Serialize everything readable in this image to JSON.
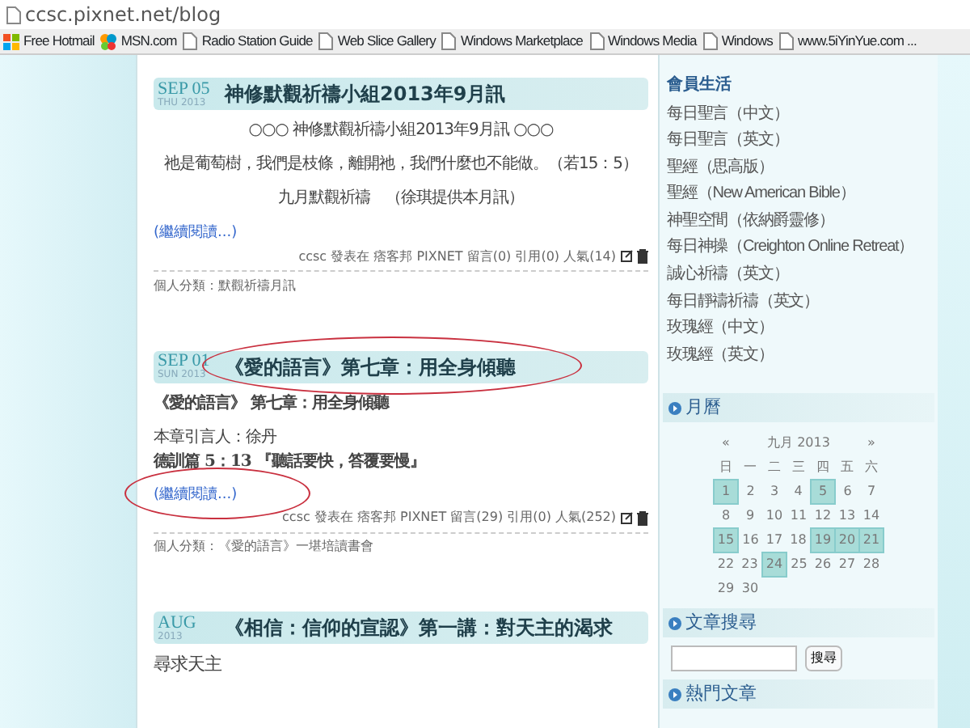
{
  "address_bar": {
    "url": "ccsc.pixnet.net/blog"
  },
  "bookmarks": [
    {
      "kind": "windows",
      "label": "Free Hotmail"
    },
    {
      "kind": "msn",
      "label": "MSN.com"
    },
    {
      "kind": "page",
      "label": "Radio Station Guide"
    },
    {
      "kind": "page",
      "label": "Web Slice Gallery"
    },
    {
      "kind": "page",
      "label": "Windows Marketplace"
    },
    {
      "kind": "page",
      "label": "Windows Media"
    },
    {
      "kind": "page",
      "label": "Windows"
    },
    {
      "kind": "page",
      "label": "www.5iYinYue.com ..."
    }
  ],
  "posts": [
    {
      "month_day": "SEP 05",
      "weekday_year": "THU 2013",
      "title": "神修默觀祈禱小組2013年9月訊",
      "circled_title": false,
      "body": [
        {
          "kind": "center",
          "text": "○○○  神修默觀祈禱小組2013年9月訊  ○○○"
        },
        {
          "kind": "center",
          "text": "祂是葡萄樹，我們是枝條，離開祂，我們什麼也不能做。（若15：5）"
        },
        {
          "kind": "center",
          "text": "九月默觀祈禱　（徐琪提供本月訊）"
        }
      ],
      "read_more": "(繼續閱讀...)",
      "circled_read_more": false,
      "footer": "ccsc 發表在 痞客邦 PIXNET 留言(0) 引用(0) 人氣(14)",
      "category": "個人分類：默觀祈禱月訊"
    },
    {
      "month_day": "SEP 01",
      "weekday_year": "SUN 2013",
      "title": "《愛的語言》第七章：用全身傾聽",
      "circled_title": true,
      "body": [
        {
          "kind": "heading",
          "text": "《愛的語言》 第七章：用全身傾聽"
        },
        {
          "kind": "plain",
          "text": "本章引言人：徐丹"
        },
        {
          "kind": "verse",
          "text": "德訓篇 5：13 『聽話要快，答覆要慢』"
        }
      ],
      "read_more": "(繼續閱讀...)",
      "circled_read_more": true,
      "footer": "ccsc 發表在 痞客邦 PIXNET 留言(29) 引用(0) 人氣(252)",
      "category": "個人分類：《愛的語言》一堪培讀書會"
    },
    {
      "month_day": "AUG",
      "weekday_year": "2013",
      "title": "《相信：信仰的宣認》第一講：對天主的渴求",
      "circled_title": false,
      "body": [
        {
          "kind": "lead",
          "text": "尋求天主"
        }
      ]
    }
  ],
  "sidebar": {
    "links_heading": "會員生活",
    "links": [
      "每日聖言（中文）",
      "每日聖言（英文）",
      "聖經（思高版）",
      "聖經（New American Bible）",
      "神聖空間（依納爵靈修）",
      "每日神操（Creighton Online Retreat）",
      "誠心祈禱（英文）",
      "每日靜禱祈禱（英文）",
      "玫瑰經（中文）",
      "玫瑰經（英文）"
    ],
    "calendar": {
      "heading": "月曆",
      "prev": "«",
      "month": "九月 2013",
      "next": "»",
      "weekdays": [
        "日",
        "一",
        "二",
        "三",
        "四",
        "五",
        "六"
      ],
      "weeks": [
        [
          {
            "day": "1",
            "has_post": true
          },
          {
            "day": "2",
            "has_post": false
          },
          {
            "day": "3",
            "has_post": false
          },
          {
            "day": "4",
            "has_post": false
          },
          {
            "day": "5",
            "has_post": true
          },
          {
            "day": "6",
            "has_post": false
          },
          {
            "day": "7",
            "has_post": false
          }
        ],
        [
          {
            "day": "8",
            "has_post": false
          },
          {
            "day": "9",
            "has_post": false
          },
          {
            "day": "10",
            "has_post": false
          },
          {
            "day": "11",
            "has_post": false
          },
          {
            "day": "12",
            "has_post": false
          },
          {
            "day": "13",
            "has_post": false
          },
          {
            "day": "14",
            "has_post": false
          }
        ],
        [
          {
            "day": "15",
            "has_post": true
          },
          {
            "day": "16",
            "has_post": false
          },
          {
            "day": "17",
            "has_post": false
          },
          {
            "day": "18",
            "has_post": false
          },
          {
            "day": "19",
            "has_post": true
          },
          {
            "day": "20",
            "has_post": true
          },
          {
            "day": "21",
            "has_post": true
          }
        ],
        [
          {
            "day": "22",
            "has_post": false
          },
          {
            "day": "23",
            "has_post": false
          },
          {
            "day": "24",
            "has_post": true
          },
          {
            "day": "25",
            "has_post": false
          },
          {
            "day": "26",
            "has_post": false
          },
          {
            "day": "27",
            "has_post": false
          },
          {
            "day": "28",
            "has_post": false
          }
        ],
        [
          {
            "day": "29",
            "has_post": false
          },
          {
            "day": "30",
            "has_post": false
          }
        ]
      ]
    },
    "search": {
      "heading": "文章搜尋",
      "button": "搜尋"
    },
    "next_heading": "熱門文章"
  }
}
